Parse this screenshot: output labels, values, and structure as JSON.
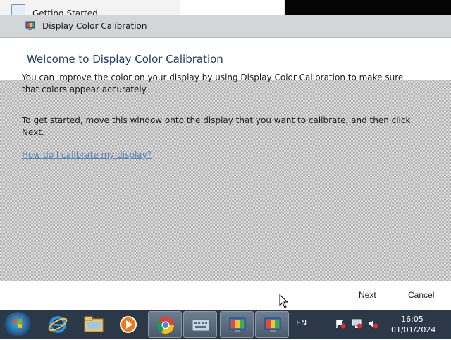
{
  "background_window": {
    "title": "Getting Started"
  },
  "dialog": {
    "title": "Display Color Calibration",
    "heading": "Welcome to Display Color Calibration",
    "paragraph1": "You can improve the color on your display by using Display Color Calibration to make sure that colors appear accurately.",
    "paragraph2": "To get started, move this window onto the display that you want to calibrate, and then click Next.",
    "help_link": "How do I calibrate my display?",
    "buttons": {
      "next": "Next",
      "cancel": "Cancel"
    }
  },
  "taskbar": {
    "items": [
      {
        "name": "internet-explorer-icon"
      },
      {
        "name": "file-explorer-icon"
      },
      {
        "name": "media-player-icon"
      },
      {
        "name": "chrome-icon"
      },
      {
        "name": "keyboard-icon"
      },
      {
        "name": "display-calibration-icon"
      },
      {
        "name": "display-calibration-icon-2"
      }
    ],
    "language": "EN",
    "time": "16:05",
    "date": "01/01/2024"
  },
  "colors": {
    "heading": "#1e3a6e",
    "link": "#2e6fb0",
    "taskbar": "#2a3848"
  }
}
